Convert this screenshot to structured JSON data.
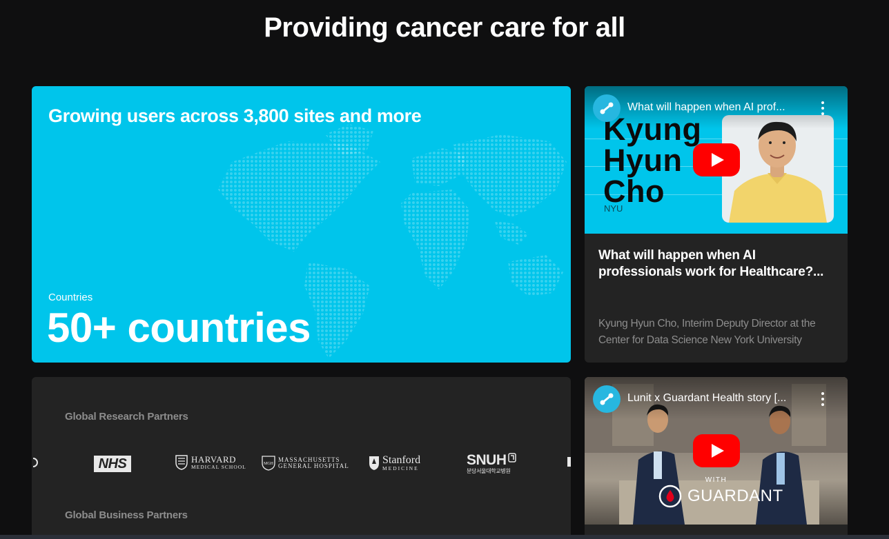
{
  "page": {
    "title": "Providing cancer care for all"
  },
  "stats": {
    "heading": "Growing users across 3,800 sites and more",
    "label": "Countries",
    "value": "50+ countries"
  },
  "video1": {
    "channel_icon": "lunit-icon",
    "yt_title": "What will happen when AI prof...",
    "thumb_name_lines": [
      "Kyung",
      "Hyun",
      "Cho"
    ],
    "thumb_org": "NYU",
    "title": "What will happen when AI professionals work for Healthcare?...",
    "description": "Kyung Hyun Cho, Interim Deputy Director at the Center for Data Science New York University"
  },
  "partners": {
    "research_heading": "Global Research Partners",
    "business_heading": "Global Business Partners",
    "logos": {
      "nhs": "NHS",
      "harvard_main": "HARVARD",
      "harvard_sub": "MEDICAL SCHOOL",
      "mgh_main": "MASSACHUSETTS",
      "mgh_sub": "GENERAL HOSPITAL",
      "stanford_main": "Stanford",
      "stanford_sub": "MEDICINE",
      "snuh_main": "SNUH",
      "snuh_sub": "분당서울대학교병원"
    }
  },
  "video2": {
    "channel_icon": "lunit-icon",
    "yt_title": "Lunit x Guardant Health story [...",
    "with_text": "WITH",
    "brand": "GUARDANT"
  },
  "colors": {
    "background": "#0f0f10",
    "accent": "#00c5eb",
    "card": "#232323",
    "muted_text": "#8d8d8d",
    "youtube_red": "#ff0000"
  }
}
